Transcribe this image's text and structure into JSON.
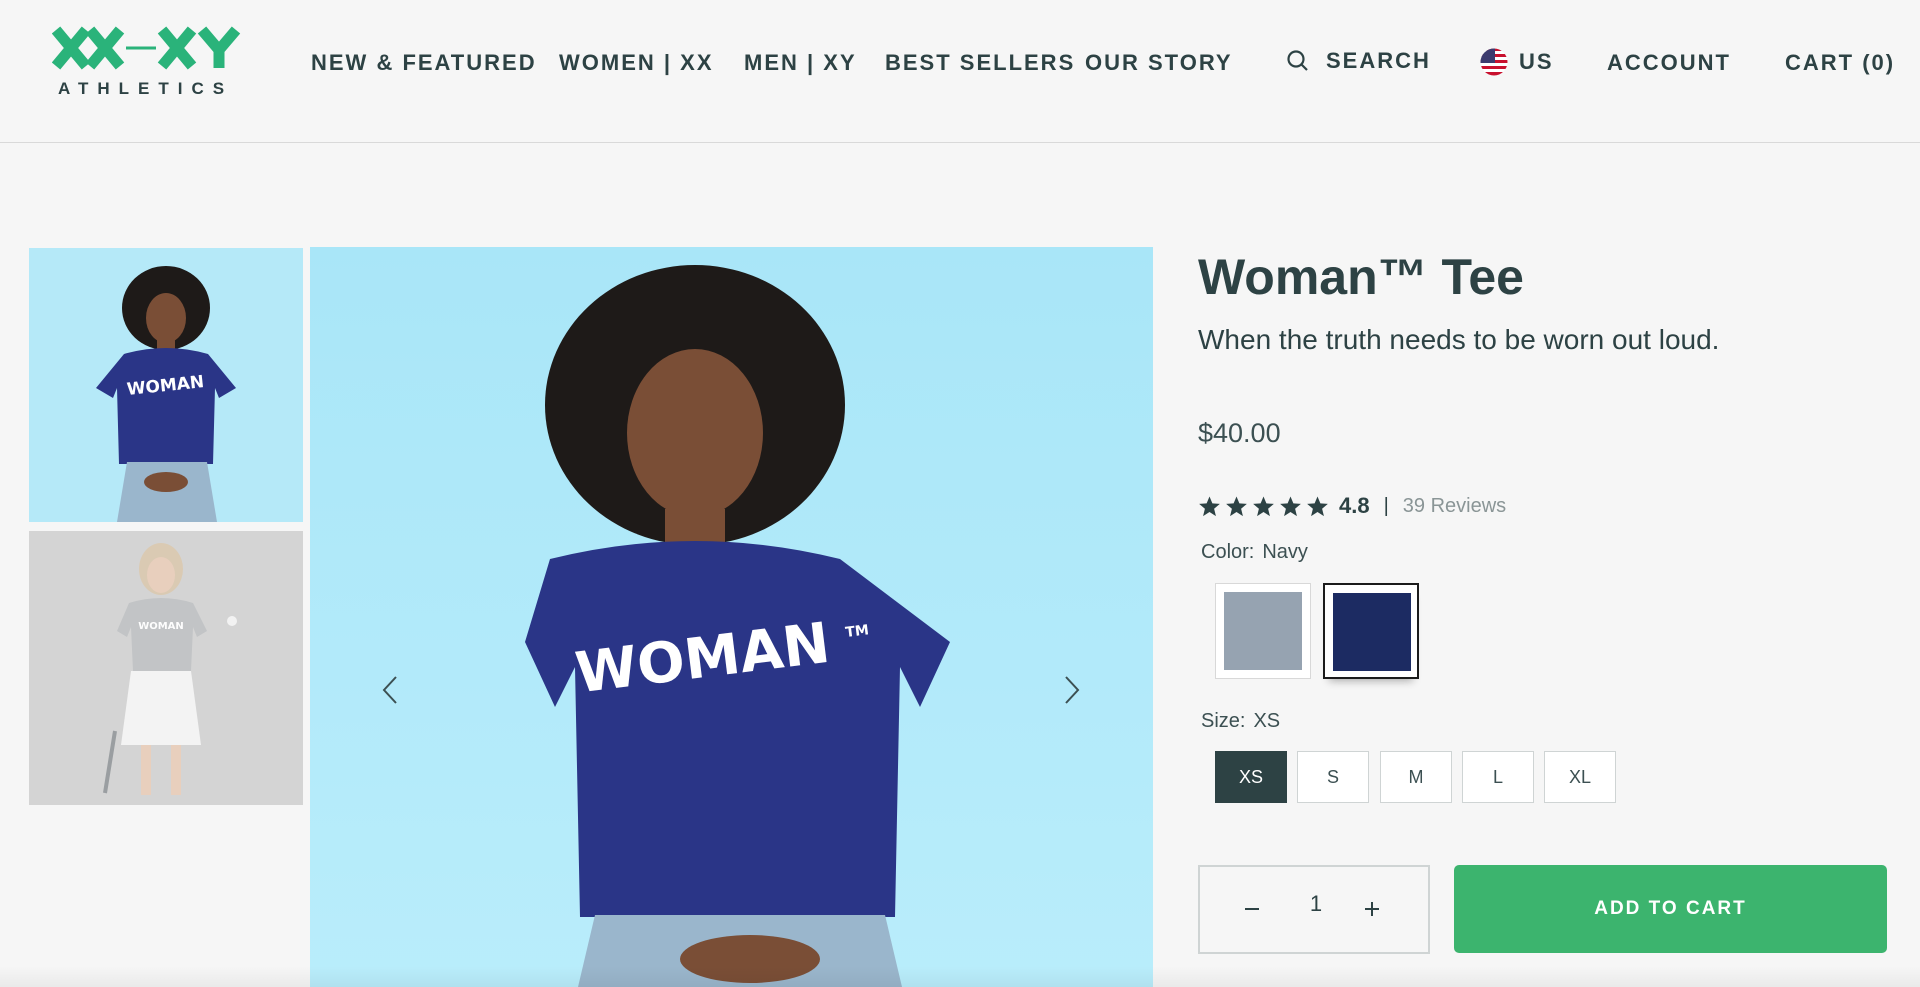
{
  "brand": {
    "logo_mark": "XX-XY",
    "logo_text": "ATHLETICS",
    "accent_color": "#2ab37a"
  },
  "nav": {
    "links": [
      "NEW & FEATURED",
      "WOMEN | XX",
      "MEN | XY",
      "BEST SELLERS",
      "OUR STORY"
    ],
    "search_label": "SEARCH",
    "locale_label": "US",
    "account_label": "ACCOUNT",
    "cart_label": "CART (0)"
  },
  "gallery": {
    "thumbnails": [
      {
        "alt": "Woman in navy tee"
      },
      {
        "alt": "Woman in gray tee with tennis ball"
      }
    ],
    "shirt_text": "WOMAN",
    "shirt_tm": "TM"
  },
  "product": {
    "title": "Woman™ Tee",
    "tagline": "When the truth needs to be worn out loud.",
    "price": "$40.00",
    "rating": 4.8,
    "rating_text": "4.8",
    "separator": "|",
    "reviews_text": "39 Reviews",
    "color_label": "Color:",
    "color_value": "Navy",
    "colors": [
      {
        "name": "Heather Gray",
        "hex": "#96a3b1"
      },
      {
        "name": "Navy",
        "hex": "#1c2b62"
      }
    ],
    "size_label": "Size:",
    "size_value": "XS",
    "sizes": [
      "XS",
      "S",
      "M",
      "L",
      "XL"
    ],
    "quantity": "1",
    "add_to_cart_label": "ADD TO CART",
    "cta_color": "#3cb46e"
  }
}
